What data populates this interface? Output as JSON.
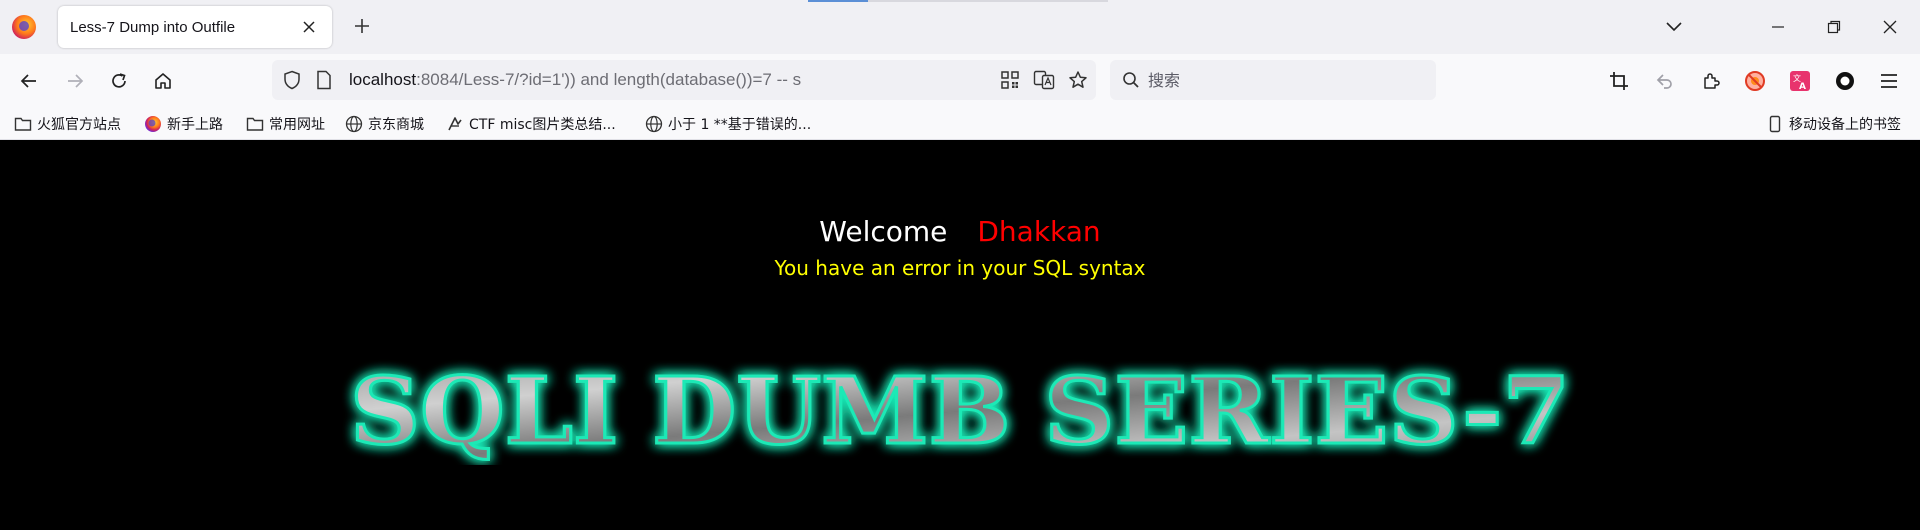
{
  "browser": {
    "tab": {
      "title": "Less-7 Dump into Outfile",
      "favicon": "firefox-icon"
    },
    "url": {
      "host": "localhost",
      "rest": ":8084/Less-7/?id=1')) and length(database())=7 -- s"
    },
    "search": {
      "placeholder": "搜索"
    },
    "bookmarks": [
      {
        "label": "火狐官方站点",
        "icon": "folder-icon"
      },
      {
        "label": "新手上路",
        "icon": "firefox-icon"
      },
      {
        "label": "常用网址",
        "icon": "folder-icon"
      },
      {
        "label": "京东商城",
        "icon": "globe-icon"
      },
      {
        "label": "CTF misc图片类总结...",
        "icon": "ctf-icon"
      },
      {
        "label": "小于 1 **基于错误的...",
        "icon": "globe-icon"
      }
    ],
    "mobile_bookmarks": "移动设备上的书签"
  },
  "page": {
    "welcome": "Welcome",
    "name": "Dhakkan",
    "error": "You have an error in your SQL syntax",
    "banner": "SQLI DUMB SERIES-7"
  },
  "colors": {
    "welcome": "#ffffff",
    "name": "#ff0000",
    "error": "#ffff00",
    "banner_glow": "#1de9b6"
  }
}
